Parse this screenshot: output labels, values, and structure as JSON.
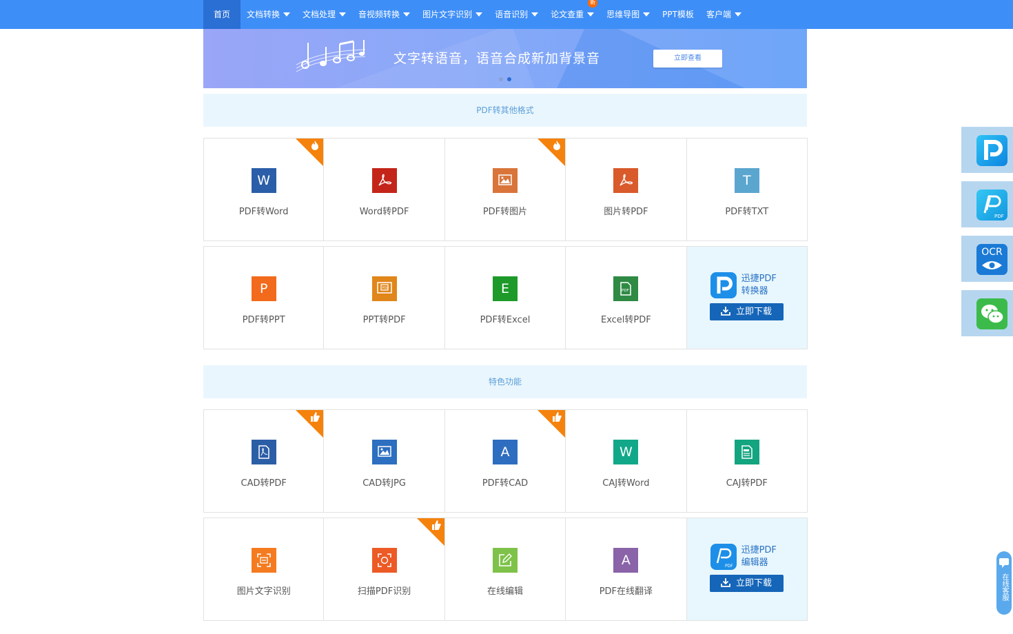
{
  "nav": {
    "items": [
      {
        "label": "首页",
        "has_caret": false
      },
      {
        "label": "文档转换",
        "has_caret": true
      },
      {
        "label": "文档处理",
        "has_caret": true
      },
      {
        "label": "音视频转换",
        "has_caret": true
      },
      {
        "label": "图片文字识别",
        "has_caret": true
      },
      {
        "label": "语音识别",
        "has_caret": true
      },
      {
        "label": "论文查重",
        "has_caret": true,
        "badge": "新"
      },
      {
        "label": "思维导图",
        "has_caret": true
      },
      {
        "label": "PPT模板",
        "has_caret": false
      },
      {
        "label": "客户端",
        "has_caret": true
      }
    ],
    "active_index": 0
  },
  "banner": {
    "text": "文字转语音，语音合成新加背景音",
    "button": "立即查看",
    "active_dot": 1
  },
  "section1": {
    "title": "PDF转其他格式",
    "tiles": [
      {
        "label": "PDF转Word",
        "icon": "word-icon",
        "glyph": "W",
        "color": "#2b5ea8",
        "corner": "fire"
      },
      {
        "label": "Word转PDF",
        "icon": "pdf-acrobat-icon",
        "glyph": "",
        "color": "#c4251a",
        "corner": ""
      },
      {
        "label": "PDF转图片",
        "icon": "image-icon",
        "glyph": "",
        "color": "#d9753a",
        "corner": "fire"
      },
      {
        "label": "图片转PDF",
        "icon": "pdf-acrobat-icon",
        "glyph": "",
        "color": "#d95a2b",
        "corner": ""
      },
      {
        "label": "PDF转TXT",
        "icon": "text-icon",
        "glyph": "T",
        "color": "#5aa6cf",
        "corner": ""
      },
      {
        "label": "PDF转PPT",
        "icon": "powerpoint-icon",
        "glyph": "P",
        "color": "#f26a1b",
        "corner": ""
      },
      {
        "label": "PPT转PDF",
        "icon": "ppt-pdf-icon",
        "glyph": "",
        "color": "#e0861a",
        "corner": ""
      },
      {
        "label": "PDF转Excel",
        "icon": "excel-icon",
        "glyph": "E",
        "color": "#1d9a2a",
        "corner": ""
      },
      {
        "label": "Excel转PDF",
        "icon": "excel-pdf-icon",
        "glyph": "",
        "color": "#2f8a44",
        "corner": ""
      }
    ],
    "promo": {
      "title_line1": "迅捷PDF",
      "title_line2": "转换器",
      "button": "立即下载"
    }
  },
  "section2": {
    "title": "特色功能",
    "tiles": [
      {
        "label": "CAD转PDF",
        "icon": "pdf-doc-icon",
        "glyph": "",
        "color": "#2c5ea6",
        "corner": "thumb"
      },
      {
        "label": "CAD转JPG",
        "icon": "image-icon",
        "glyph": "",
        "color": "#2d6fc0",
        "corner": ""
      },
      {
        "label": "PDF转CAD",
        "icon": "cad-icon",
        "glyph": "A",
        "color": "#2e6dc0",
        "corner": "thumb"
      },
      {
        "label": "CAJ转Word",
        "icon": "word-icon",
        "glyph": "W",
        "color": "#11a889",
        "corner": ""
      },
      {
        "label": "CAJ转PDF",
        "icon": "caj-pdf-icon",
        "glyph": "",
        "color": "#13a480",
        "corner": ""
      },
      {
        "label": "图片文字识别",
        "icon": "scan-text-icon",
        "glyph": "",
        "color": "#f47b20",
        "corner": ""
      },
      {
        "label": "扫描PDF识别",
        "icon": "scan-icon",
        "glyph": "",
        "color": "#ec5a26",
        "corner": "thumb"
      },
      {
        "label": "在线编辑",
        "icon": "edit-icon",
        "glyph": "",
        "color": "#7ec24a",
        "corner": ""
      },
      {
        "label": "PDF在线翻译",
        "icon": "translate-icon",
        "glyph": "A",
        "color": "#8a63a8",
        "corner": ""
      }
    ],
    "promo": {
      "title_line1": "迅捷PDF",
      "title_line2": "编辑器",
      "button": "立即下载"
    }
  },
  "side": {
    "items": [
      "pdf-converter-app-icon",
      "pdf-editor-app-icon",
      "ocr-icon",
      "wechat-icon"
    ],
    "ocr_text": "OCR",
    "chat_text": "在线客服"
  },
  "colors": {
    "nav": "#3e8ef7",
    "nav_active": "#2a6fd4",
    "accent": "#1565b8",
    "section_bg": "#eaf6fd"
  }
}
